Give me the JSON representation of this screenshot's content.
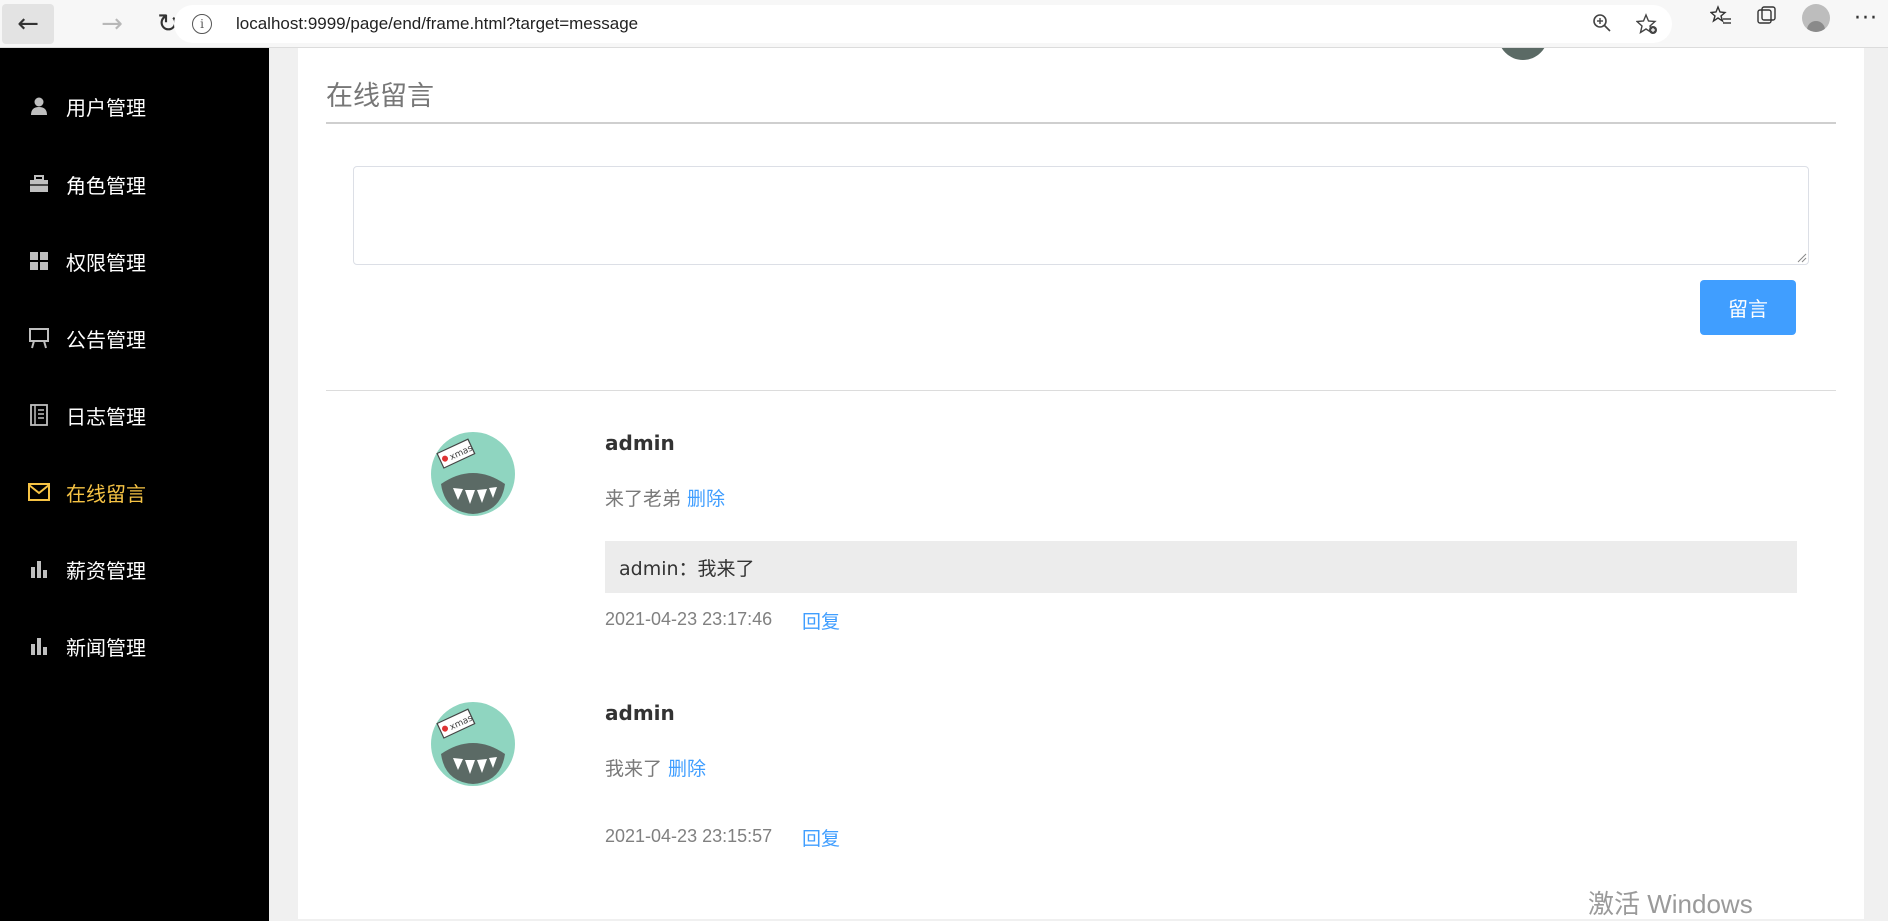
{
  "browser": {
    "url": "localhost:9999/page/end/frame.html?target=message",
    "back_icon": "←",
    "forward_icon": "→",
    "reload_icon": "↻"
  },
  "sidebar": {
    "items": [
      {
        "label": "用户管理",
        "icon": "person-icon",
        "active": false
      },
      {
        "label": "角色管理",
        "icon": "briefcase-icon",
        "active": false
      },
      {
        "label": "权限管理",
        "icon": "grid-icon",
        "active": false
      },
      {
        "label": "公告管理",
        "icon": "easel-icon",
        "active": false
      },
      {
        "label": "日志管理",
        "icon": "notebook-icon",
        "active": false
      },
      {
        "label": "在线留言",
        "icon": "envelope-icon",
        "active": true
      },
      {
        "label": "薪资管理",
        "icon": "bar-chart-icon",
        "active": false
      },
      {
        "label": "新闻管理",
        "icon": "bar-chart-icon",
        "active": false
      }
    ],
    "active_color": "#f6c344"
  },
  "main": {
    "title": "在线留言",
    "input_value": "",
    "submit_label": "留言",
    "accent_color": "#409eff",
    "comments": [
      {
        "author": "admin",
        "text": "来了老弟",
        "delete_label": "删除",
        "reply": "admin：我来了",
        "time": "2021-04-23 23:17:46",
        "reply_label": "回复"
      },
      {
        "author": "admin",
        "text": "我来了",
        "delete_label": "删除",
        "reply": "",
        "time": "2021-04-23 23:15:57",
        "reply_label": "回复"
      }
    ]
  },
  "watermark": "激活 Windows"
}
